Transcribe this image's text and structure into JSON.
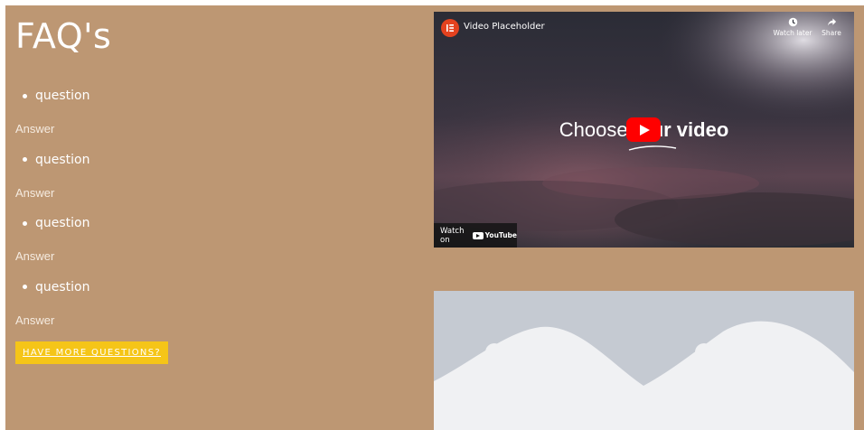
{
  "faq": {
    "title": "FAQ's",
    "items": [
      {
        "question": "question",
        "answer": "Answer"
      },
      {
        "question": "question",
        "answer": "Answer"
      },
      {
        "question": "question",
        "answer": "Answer"
      },
      {
        "question": "question",
        "answer": "Answer"
      }
    ],
    "more_button": "HAVE MORE QUESTIONS?"
  },
  "video": {
    "title": "Video Placeholder",
    "watch_later": "Watch later",
    "share": "Share",
    "headline_left": "Choose ",
    "headline_right": "ur video",
    "watch_on": "Watch on",
    "youtube": "YouTube"
  },
  "colors": {
    "page_bg": "#bd9773",
    "button_bg": "#f5c518",
    "placeholder_bg": "#c5cad2",
    "placeholder_shape": "#f0f1f3"
  }
}
